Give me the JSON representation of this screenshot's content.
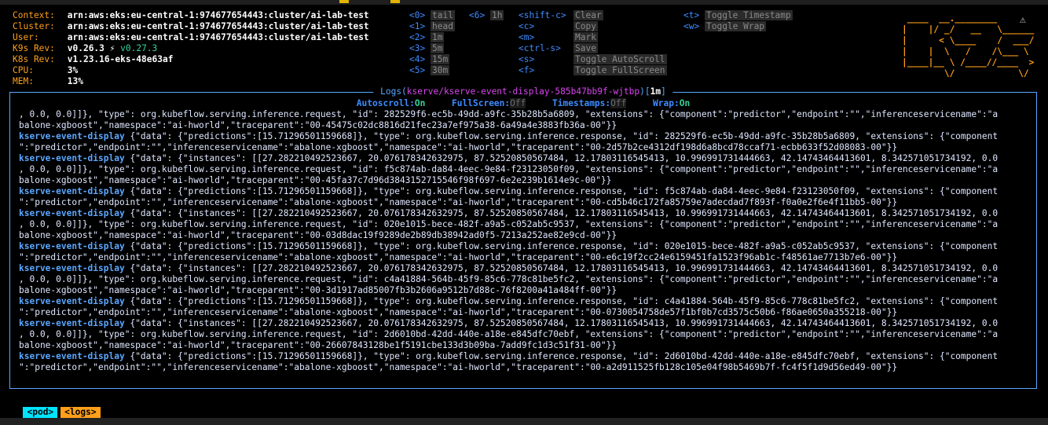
{
  "header": {
    "info": [
      {
        "key": "Context:",
        "value": "arn:aws:eks:eu-central-1:974677654443:cluster/ai-lab-test"
      },
      {
        "key": "Cluster:",
        "value": "arn:aws:eks:eu-central-1:974677654443:cluster/ai-lab-test"
      },
      {
        "key": "User:",
        "value": "arn:aws:eks:eu-central-1:974677654443:cluster/ai-lab-test"
      },
      {
        "key": "K9s Rev:",
        "value": "v0.26.3 ⚡",
        "extra": "v0.27.3"
      },
      {
        "key": "K8s Rev:",
        "value": "v1.23.16-eks-48e63af"
      },
      {
        "key": "CPU:",
        "value": "3%"
      },
      {
        "key": "MEM:",
        "value": "13%"
      }
    ],
    "hints_col1": [
      {
        "key": "<0>",
        "label": "tail"
      },
      {
        "key": "<1>",
        "label": "head"
      },
      {
        "key": "<2>",
        "label": "1m"
      },
      {
        "key": "<3>",
        "label": "5m"
      },
      {
        "key": "<4>",
        "label": "15m"
      },
      {
        "key": "<5>",
        "label": "30m"
      }
    ],
    "hints_col2": [
      {
        "key": "<6>",
        "label": "1h"
      }
    ],
    "hints_col3": [
      {
        "key": "<shift-c>",
        "label": "Clear"
      },
      {
        "key": "<c>",
        "label": "Copy"
      },
      {
        "key": "<m>",
        "label": "Mark"
      },
      {
        "key": "<ctrl-s>",
        "label": "Save"
      },
      {
        "key": "<s>",
        "label": "Toggle AutoScroll"
      },
      {
        "key": "<f>",
        "label": "Toggle FullScreen"
      }
    ],
    "hints_col4": [
      {
        "key": "<t>",
        "label": "Toggle Timestamp"
      },
      {
        "key": "<w>",
        "label": "Toggle Wrap"
      }
    ],
    "logo_lines": [
      " ____  __.________       ",
      "|    |/ _/   __   \\______",
      "|      < \\____    /  ___/",
      "|    |  \\   /    /\\___ \\ ",
      "|____|__ \\ /____//____  >",
      "        \\/            \\/ "
    ]
  },
  "logs_panel": {
    "title_prefix": " Logs(",
    "pod": "kserve/kserve-event-display-585b47bb9f-wjtbp",
    "title_mid": ")[",
    "since": "1m",
    "title_suffix": "] ",
    "autoscroll_label": "Autoscroll:",
    "autoscroll_value": "On",
    "fullscreen_label": "FullScreen:",
    "fullscreen_value": "Off",
    "timestamps_label": "Timestamps:",
    "timestamps_value": "Off",
    "wrap_label": "Wrap:",
    "wrap_value": "On",
    "lines": [
      {
        "src": "",
        "text": ", 0.0, 0.0]]}, \"type\": org.kubeflow.serving.inference.request, \"id\": 282529f6-ec5b-49dd-a9fc-35b28b5a6809, \"extensions\": {\"component\":\"predictor\",\"endpoint\":\"\",\"inferenceservicename\":\"a"
      },
      {
        "src": "",
        "text": "balone-xgboost\",\"namespace\":\"ai-hworld\",\"traceparent\":\"00-45475c02dc8816d21fec23a7ef975a38-6a49a4e3883fb36a-00\"}}"
      },
      {
        "src": "kserve-event-display",
        "text": " {\"data\": {\"predictions\":[15.71296501159668]}, \"type\": org.kubeflow.serving.inference.response, \"id\": 282529f6-ec5b-49dd-a9fc-35b28b5a6809, \"extensions\": {\"component"
      },
      {
        "src": "",
        "text": "\":\"predictor\",\"endpoint\":\"\",\"inferenceservicename\":\"abalone-xgboost\",\"namespace\":\"ai-hworld\",\"traceparent\":\"00-2d57b2ce4312df198d6a8bcd78ccaf71-ecbb633f52d08083-00\"}}"
      },
      {
        "src": "kserve-event-display",
        "text": " {\"data\": {\"instances\": [[27.282210492523667, 20.076178342632975, 87.52520850567484, 12.17803116545413, 10.996991731444663, 42.14743464413601, 8.342571051734192, 0.0"
      },
      {
        "src": "",
        "text": ", 0.0, 0.0]]}, \"type\": org.kubeflow.serving.inference.request, \"id\": f5c874ab-da84-4eec-9e84-f23123050f09, \"extensions\": {\"component\":\"predictor\",\"endpoint\":\"\",\"inferenceservicename\":\"a"
      },
      {
        "src": "",
        "text": "balone-xgboost\",\"namespace\":\"ai-hworld\",\"traceparent\":\"00-45fa37c7d96d3843152715546f98f697-6e2e239b1614e9c-00\"}}"
      },
      {
        "src": "kserve-event-display",
        "text": " {\"data\": {\"predictions\":[15.71296501159668]}, \"type\": org.kubeflow.serving.inference.response, \"id\": f5c874ab-da84-4eec-9e84-f23123050f09, \"extensions\": {\"component"
      },
      {
        "src": "",
        "text": "\":\"predictor\",\"endpoint\":\"\",\"inferenceservicename\":\"abalone-xgboost\",\"namespace\":\"ai-hworld\",\"traceparent\":\"00-cd5b46c172fa85759e7adecdad7f893f-f0a0e2f6e4f11bb5-00\"}}"
      },
      {
        "src": "kserve-event-display",
        "text": " {\"data\": {\"instances\": [[27.282210492523667, 20.076178342632975, 87.52520850567484, 12.17803116545413, 10.996991731444663, 42.14743464413601, 8.342571051734192, 0.0"
      },
      {
        "src": "",
        "text": ", 0.0, 0.0]]}, \"type\": org.kubeflow.serving.inference.request, \"id\": 020e1015-bece-482f-a9a5-c052ab5c9537, \"extensions\": {\"component\":\"predictor\",\"endpoint\":\"\",\"inferenceservicename\":\"a"
      },
      {
        "src": "",
        "text": "balone-xgboost\",\"namespace\":\"ai-hworld\",\"traceparent\":\"00-03d8dac19f9289de2b89db38942ad0f5-7213a252ae82e9cd-00\"}}"
      },
      {
        "src": "kserve-event-display",
        "text": " {\"data\": {\"predictions\":[15.71296501159668]}, \"type\": org.kubeflow.serving.inference.response, \"id\": 020e1015-bece-482f-a9a5-c052ab5c9537, \"extensions\": {\"component"
      },
      {
        "src": "",
        "text": "\":\"predictor\",\"endpoint\":\"\",\"inferenceservicename\":\"abalone-xgboost\",\"namespace\":\"ai-hworld\",\"traceparent\":\"00-e6c19f2cc24e6159451fa1523f96ab1c-f48561ae7713b7e6-00\"}}"
      },
      {
        "src": "kserve-event-display",
        "text": " {\"data\": {\"instances\": [[27.282210492523667, 20.076178342632975, 87.52520850567484, 12.17803116545413, 10.996991731444663, 42.14743464413601, 8.342571051734192, 0.0"
      },
      {
        "src": "",
        "text": ", 0.0, 0.0]]}, \"type\": org.kubeflow.serving.inference.request, \"id\": c4a41884-564b-45f9-85c6-778c81be5fc2, \"extensions\": {\"component\":\"predictor\",\"endpoint\":\"\",\"inferenceservicename\":\"a"
      },
      {
        "src": "",
        "text": "balone-xgboost\",\"namespace\":\"ai-hworld\",\"traceparent\":\"00-3d1917ad85007fb3b2606a9512b7d88c-76f8200a41a484ff-00\"}}"
      },
      {
        "src": "kserve-event-display",
        "text": " {\"data\": {\"predictions\":[15.71296501159668]}, \"type\": org.kubeflow.serving.inference.response, \"id\": c4a41884-564b-45f9-85c6-778c81be5fc2, \"extensions\": {\"component"
      },
      {
        "src": "",
        "text": "\":\"predictor\",\"endpoint\":\"\",\"inferenceservicename\":\"abalone-xgboost\",\"namespace\":\"ai-hworld\",\"traceparent\":\"00-0730054758de57f1bf0b7cd3575c50b6-f86ae0650a355218-00\"}}"
      },
      {
        "src": "kserve-event-display",
        "text": " {\"data\": {\"instances\": [[27.282210492523667, 20.076178342632975, 87.52520850567484, 12.17803116545413, 10.996991731444663, 42.14743464413601, 8.342571051734192, 0.0"
      },
      {
        "src": "",
        "text": ", 0.0, 0.0]]}, \"type\": org.kubeflow.serving.inference.request, \"id\": 2d6010bd-42dd-440e-a18e-e845dfc70ebf, \"extensions\": {\"component\":\"predictor\",\"endpoint\":\"\",\"inferenceservicename\":\"a"
      },
      {
        "src": "",
        "text": "balone-xgboost\",\"namespace\":\"ai-hworld\",\"traceparent\":\"00-26607843128be1f5191cbe133d3b09ba-7add9fc1d3c51f31-00\"}}"
      },
      {
        "src": "kserve-event-display",
        "text": " {\"data\": {\"predictions\":[15.71296501159668]}, \"type\": org.kubeflow.serving.inference.response, \"id\": 2d6010bd-42dd-440e-a18e-e845dfc70ebf, \"extensions\": {\"component"
      },
      {
        "src": "",
        "text": "\":\"predictor\",\"endpoint\":\"\",\"inferenceservicename\":\"abalone-xgboost\",\"namespace\":\"ai-hworld\",\"traceparent\":\"00-a2d911525fb128c105e04f98b5469b7f-fc4f5f1d9d56ed49-00\"}}"
      }
    ]
  },
  "breadcrumbs": [
    "<pod>",
    "<logs>"
  ],
  "colors": {
    "accent": "#5aa7ff",
    "warning": "#ff9f1a",
    "on": "#36d399",
    "pod": "#d946ef",
    "crumb_pod": "#00e5ff",
    "crumb_logs": "#ff9f1a"
  },
  "icons": {
    "warning": "warning-icon"
  }
}
